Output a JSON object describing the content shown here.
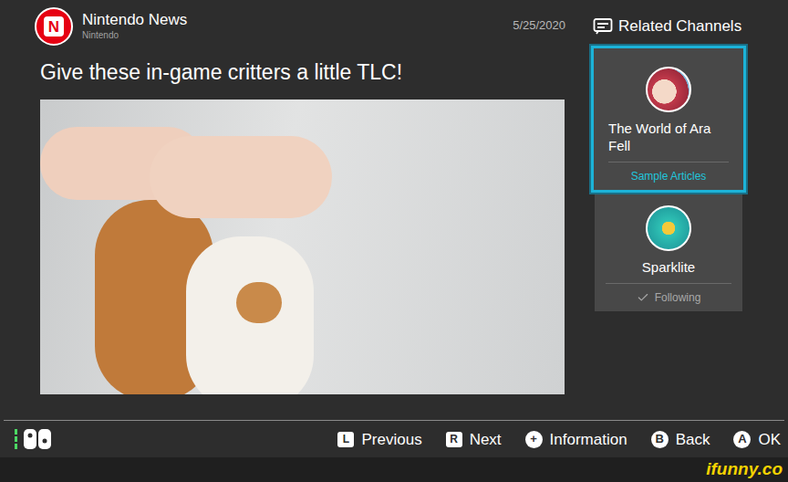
{
  "header": {
    "logo": "N",
    "channel": "Nintendo News",
    "publisher": "Nintendo",
    "date": "5/25/2020"
  },
  "article": {
    "headline": "Give these in-game critters a little TLC!"
  },
  "related": {
    "title": "Related Channels",
    "channels": [
      {
        "name": "The World of Ara Fell",
        "status": "Sample Articles",
        "following": false,
        "selected": true
      },
      {
        "name": "Sparklite",
        "status": "Following",
        "following": true,
        "selected": false
      }
    ]
  },
  "footer": {
    "buttons": [
      {
        "key": "L",
        "label": "Previous",
        "kind": "shoulder"
      },
      {
        "key": "R",
        "label": "Next",
        "kind": "shoulder"
      },
      {
        "key": "+",
        "label": "Information",
        "kind": "round"
      },
      {
        "key": "B",
        "label": "Back",
        "kind": "round"
      },
      {
        "key": "A",
        "label": "OK",
        "kind": "round"
      }
    ]
  },
  "watermark": "ifunny.co"
}
